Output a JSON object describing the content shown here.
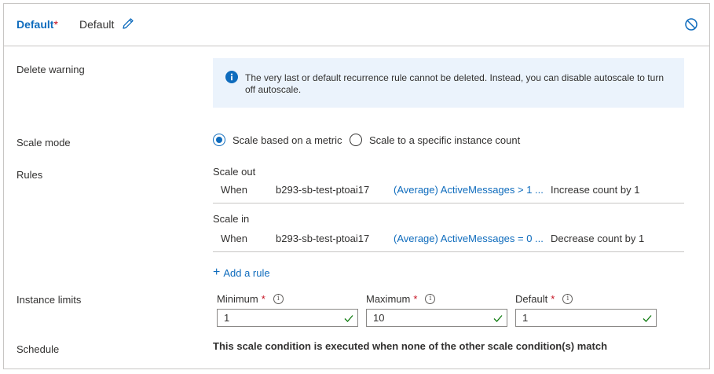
{
  "header": {
    "title": "Default",
    "required_mark": "*",
    "name": "Default",
    "edit_icon": "pencil-icon",
    "disable_icon": "prohibited-icon"
  },
  "delete_warning": {
    "label": "Delete warning",
    "icon": "info-icon",
    "text": "The very last or default recurrence rule cannot be deleted. Instead, you can disable autoscale to turn off autoscale."
  },
  "scale_mode": {
    "label": "Scale mode",
    "options": [
      {
        "label": "Scale based on a metric",
        "selected": true
      },
      {
        "label": "Scale to a specific instance count",
        "selected": false
      }
    ]
  },
  "rules": {
    "label": "Rules",
    "scale_out": {
      "label": "Scale out",
      "when": "When",
      "resource": "b293-sb-test-ptoai17",
      "metric": "(Average) ActiveMessages > 1 ...",
      "action": "Increase count by 1"
    },
    "scale_in": {
      "label": "Scale in",
      "when": "When",
      "resource": "b293-sb-test-ptoai17",
      "metric": "(Average) ActiveMessages = 0 ...",
      "action": "Decrease count by 1"
    },
    "add_rule": "Add a rule"
  },
  "instance_limits": {
    "label": "Instance limits",
    "fields": [
      {
        "label": "Minimum",
        "required": "*",
        "info": "i",
        "value": "1"
      },
      {
        "label": "Maximum",
        "required": "*",
        "info": "i",
        "value": "10"
      },
      {
        "label": "Default",
        "required": "*",
        "info": "i",
        "value": "1"
      }
    ]
  },
  "schedule": {
    "label": "Schedule",
    "text": "This scale condition is executed when none of the other scale condition(s) match"
  },
  "colors": {
    "accent": "#0f6cbd",
    "required": "#c50f1f",
    "info_bg": "#ebf3fc",
    "valid": "#107c10"
  }
}
